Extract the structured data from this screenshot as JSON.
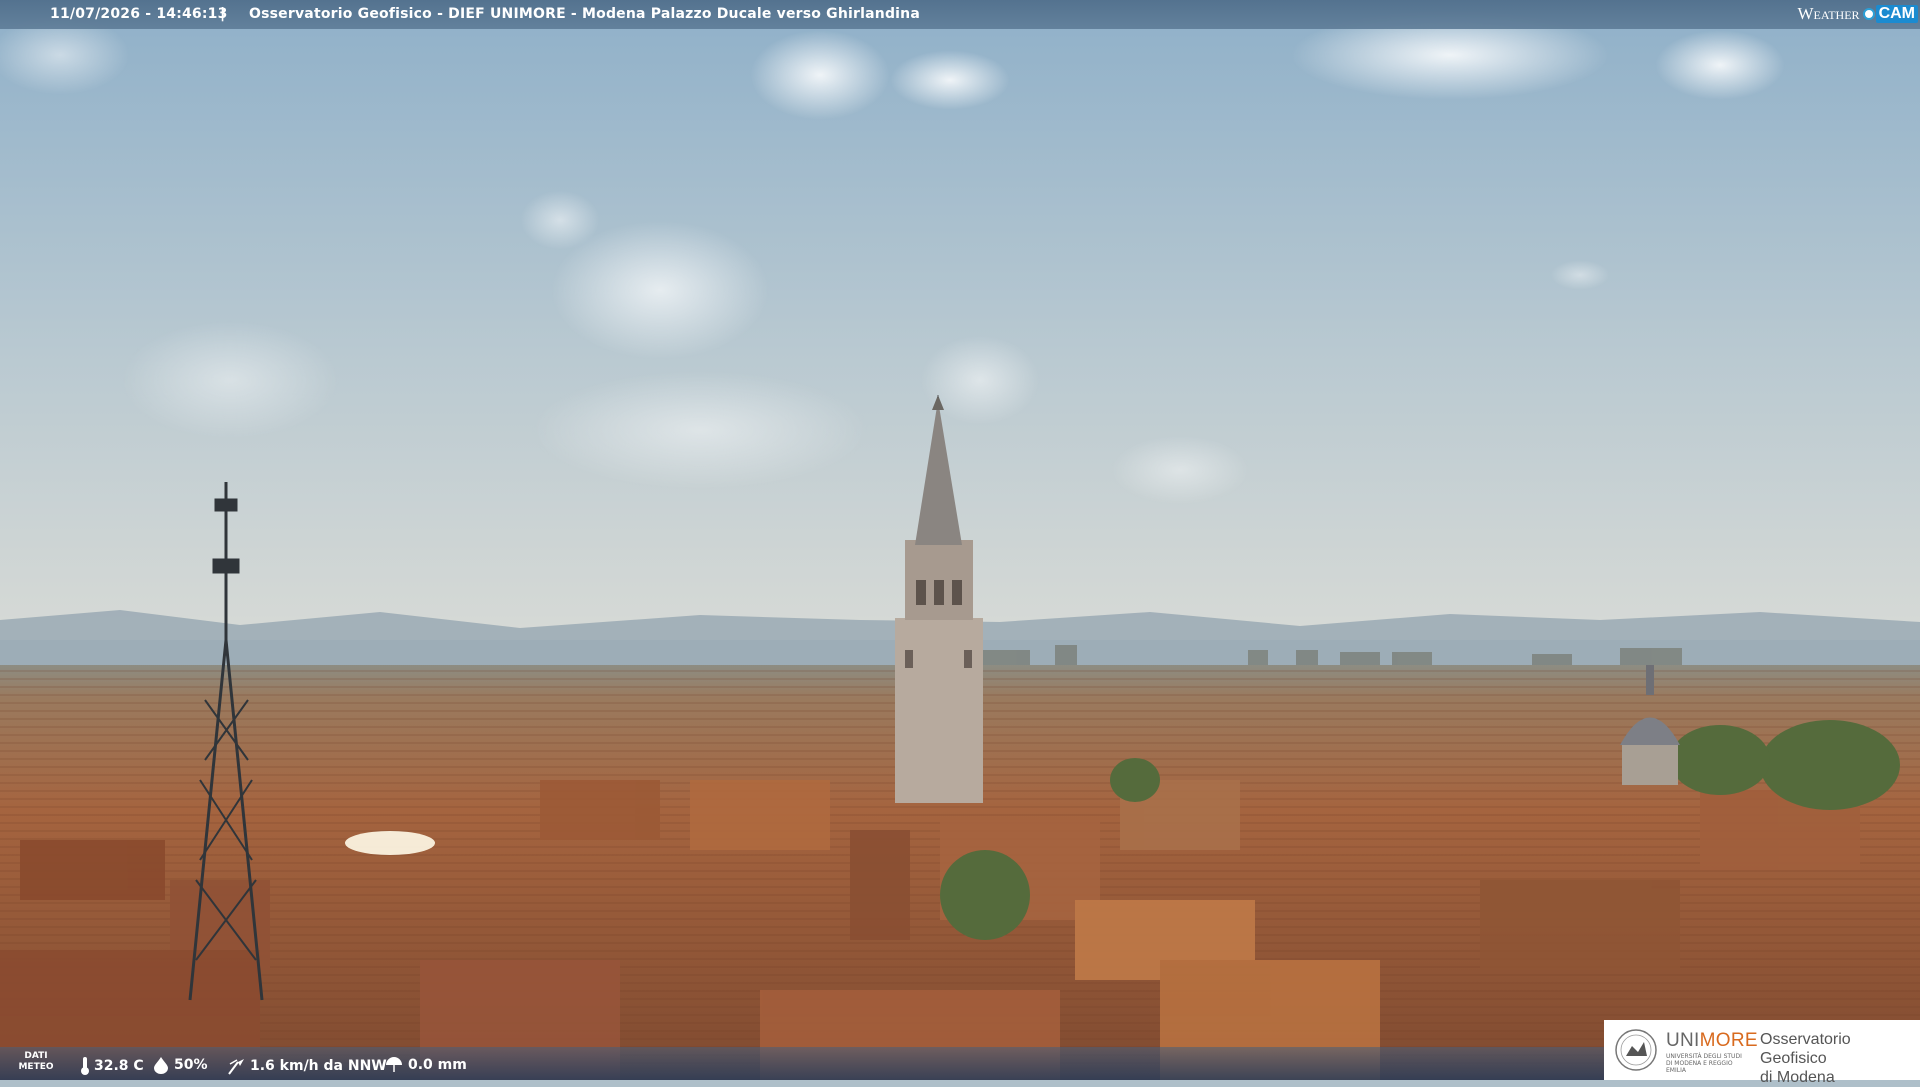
{
  "header": {
    "timestamp": "11/07/2026 - 14:46:13",
    "separator": "|",
    "title": "Osservatorio Geofisico - DIEF UNIMORE - Modena Palazzo Ducale verso Ghirlandina",
    "brand_weather": "Weather",
    "brand_cam": "CAM"
  },
  "weather": {
    "label_line1": "DATI",
    "label_line2": "METEO",
    "temperature": "32.8 C",
    "humidity": "50%",
    "wind": "1.6 km/h da NNW",
    "rain": "0.0 mm",
    "icons": [
      "thermometer-icon",
      "humidity-drop-icon",
      "wind-icon",
      "rain-icon"
    ]
  },
  "logo": {
    "uni_prefix": "UNI",
    "uni_suffix": "MORE",
    "uni_subtitle": "UNIVERSITÀ DEGLI STUDI DI MODENA E REGGIO EMILIA",
    "observatory_line1": "Osservatorio Geofisico",
    "observatory_line2": "di Modena"
  },
  "colors": {
    "sky_top": "#8fb0c9",
    "sky_horizon": "#d4d8d6",
    "roofs": "#a8623c",
    "accent_orange": "#d86a1e"
  }
}
